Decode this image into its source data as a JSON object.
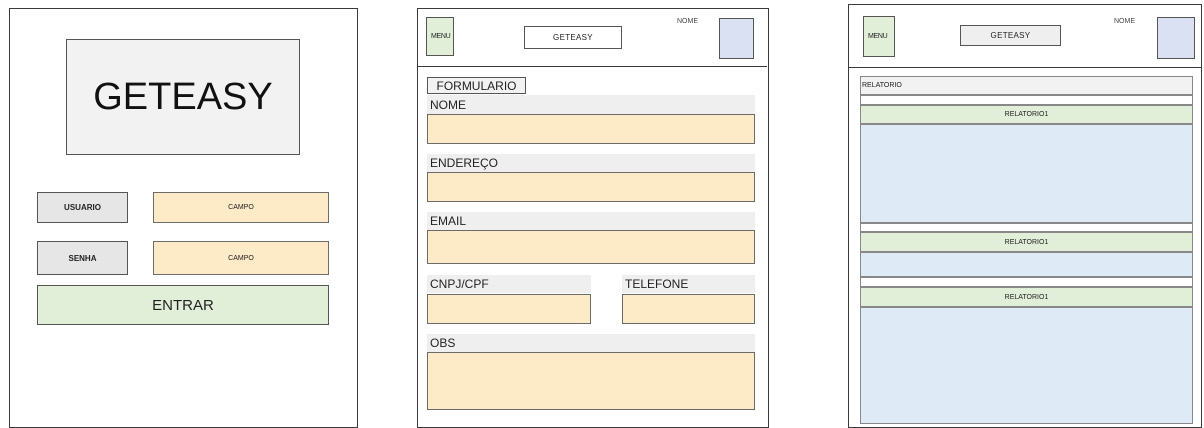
{
  "login": {
    "logo_text": "GETEASY",
    "user_label": "USUARIO",
    "user_field": "CAMPO",
    "pass_label": "SENHA",
    "pass_field": "CAMPO",
    "submit_label": "ENTRAR"
  },
  "form_screen": {
    "header": {
      "menu_label": "MENU",
      "title": "GETEASY",
      "user_name": "NOME"
    },
    "section_title": "FORMULARIO",
    "fields": {
      "nome": "NOME",
      "endereco": "ENDEREÇO",
      "email": "EMAIL",
      "cnpj": "CNPJ/CPF",
      "telefone": "TELEFONE",
      "obs": "OBS"
    }
  },
  "report_screen": {
    "header": {
      "menu_label": "MENU",
      "title": "GETEASY",
      "user_name": "NOME"
    },
    "section_title": "RELATORIO",
    "reports": [
      "RELATORIO1",
      "RELATORIO1",
      "RELATORIO1"
    ]
  },
  "colors": {
    "field_fill": "#fdebc8",
    "menu_fill": "#e1efd9",
    "avatar_fill": "#d9e1f2",
    "report_body_fill": "#deeaf6",
    "button_fill": "#e1efd9"
  }
}
